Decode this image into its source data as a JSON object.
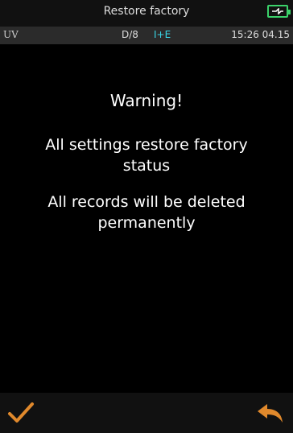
{
  "header": {
    "title": "Restore factory",
    "battery_icon": "battery-charging-icon"
  },
  "status": {
    "light_source": "UV",
    "geometry": "D/8",
    "mode": "I+E",
    "datetime": "15:26 04.15"
  },
  "content": {
    "warning_title": "Warning!",
    "message_settings": "All settings restore factory status",
    "message_records": "All records will be deleted permanently"
  },
  "footer": {
    "confirm_icon": "checkmark-icon",
    "back_icon": "back-arrow-icon"
  },
  "colors": {
    "background": "#000000",
    "accent_orange": "#e0892c",
    "battery_green": "#3bd16a",
    "mode_cyan": "#38d6e6"
  }
}
